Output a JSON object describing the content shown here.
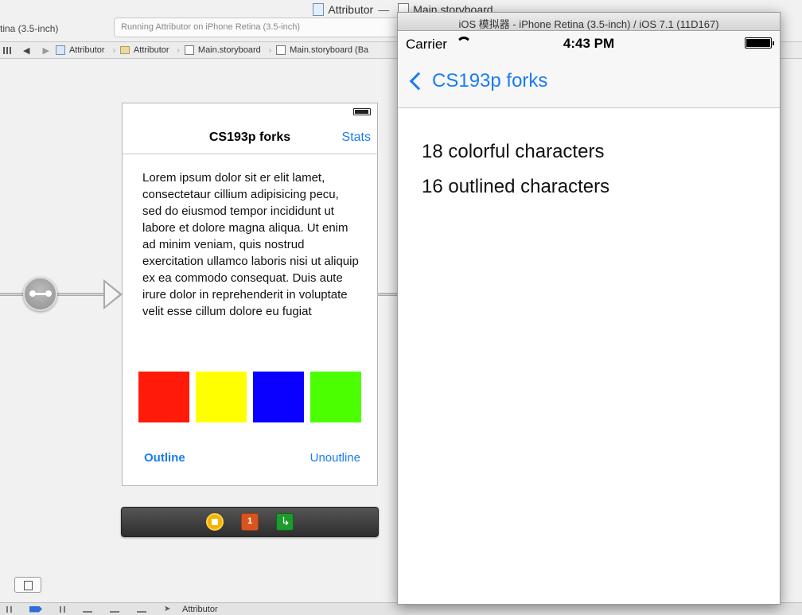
{
  "xcode": {
    "window_title_project": "Attributor",
    "window_title_sep": "—",
    "window_title_file": "Main.storyboard",
    "scheme_text": "tina (3.5-inch)",
    "activity_text": "Running Attributor on iPhone Retina (3.5-inch)",
    "jumpbar": [
      "Attributor",
      "Attributor",
      "Main.storyboard",
      "Main.storyboard (Ba"
    ]
  },
  "storyboard": {
    "scene": {
      "nav_title": "CS193p forks",
      "nav_right": "Stats",
      "body_text": "Lorem ipsum dolor sit er elit lamet, consectetaur cillium adipisicing pecu, sed do eiusmod tempor incididunt ut labore et dolore magna aliqua. Ut enim ad minim veniam, quis nostrud exercitation ullamco laboris nisi ut aliquip ex ea commodo consequat. Duis aute irure dolor in reprehenderit in voluptate velit esse cillum dolore eu fugiat",
      "swatches": [
        "#ff1a0a",
        "#ffff00",
        "#0a00ff",
        "#4cff00"
      ],
      "outline_label": "Outline",
      "unoutline_label": "Unoutline"
    },
    "dock_icons": [
      "view-controller-icon",
      "first-responder-icon",
      "exit-icon"
    ]
  },
  "debug": {
    "target_label": "Attributor"
  },
  "simulator": {
    "title": "iOS 模拟器 - iPhone Retina (3.5-inch) / iOS 7.1 (11D167)",
    "carrier": "Carrier",
    "time": "4:43 PM",
    "back_label": "CS193p forks",
    "lines": [
      "18 colorful characters",
      "16 outlined characters"
    ]
  }
}
